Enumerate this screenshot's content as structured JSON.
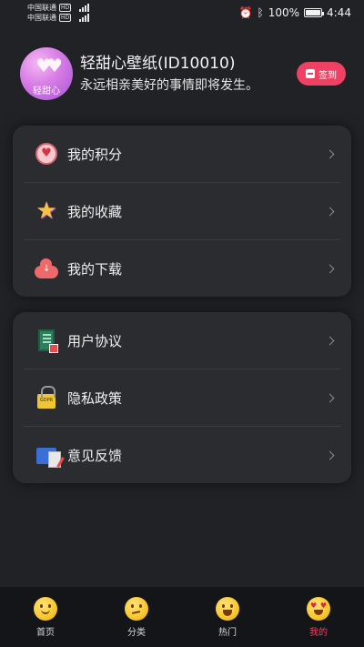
{
  "status_bar": {
    "carrier_1": "中国联通",
    "carrier_2": "中国联通",
    "hd_tag": "HD",
    "battery": "100%",
    "battery_level": 1.0,
    "time": "4:44"
  },
  "profile": {
    "avatar_label": "轻甜心",
    "name": "轻甜心壁纸(ID10010)",
    "motto": "永远相亲美好的事情即将发生。",
    "signin_label": "签到"
  },
  "menu_group_1": [
    {
      "label": "我的积分",
      "icon": "points-heart-icon"
    },
    {
      "label": "我的收藏",
      "icon": "star-icon"
    },
    {
      "label": "我的下载",
      "icon": "cloud-download-icon"
    }
  ],
  "menu_group_2": [
    {
      "label": "用户协议",
      "icon": "document-lock-icon"
    },
    {
      "label": "隐私政策",
      "icon": "gdpr-lock-icon"
    },
    {
      "label": "意见反馈",
      "icon": "feedback-icon"
    }
  ],
  "tabs": [
    {
      "label": "首页",
      "icon": "smile-face-icon"
    },
    {
      "label": "分类",
      "icon": "smirk-face-icon"
    },
    {
      "label": "热门",
      "icon": "grin-face-icon"
    },
    {
      "label": "我的",
      "icon": "heart-eyes-face-icon",
      "active": true
    }
  ],
  "colors": {
    "accent": "#ee4163",
    "background": "#202226",
    "card": "#2a2c30"
  }
}
